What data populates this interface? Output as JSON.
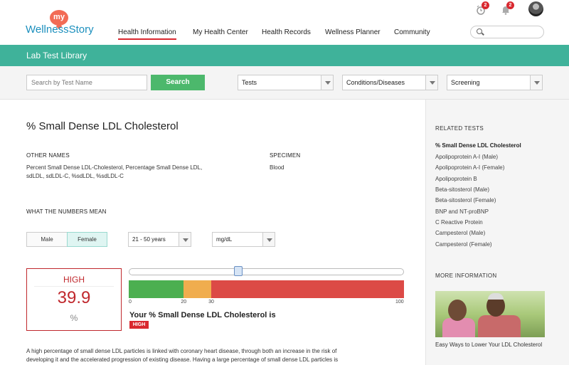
{
  "header": {
    "logo_my": "my",
    "logo_name": "WellnessStory",
    "nav": [
      {
        "label": "Health Information",
        "active": true
      },
      {
        "label": "My Health Center",
        "active": false
      },
      {
        "label": "Health Records",
        "active": false
      },
      {
        "label": "Wellness Planner",
        "active": false
      },
      {
        "label": "Community",
        "active": false
      }
    ],
    "alarm_badge": "2",
    "bell_badge": "2",
    "search_placeholder": ""
  },
  "banner": {
    "title": "Lab Test Library"
  },
  "filters": {
    "search_placeholder": "Search by Test Name",
    "search_button": "Search",
    "dropdowns": [
      "Tests",
      "Conditions/Diseases",
      "Screening"
    ]
  },
  "test": {
    "title": "% Small Dense LDL Cholesterol",
    "other_names_label": "OTHER NAMES",
    "other_names_line1": "Percent Small Dense LDL-Cholesterol, Percentage Small Dense LDL,",
    "other_names_line2": "sdLDL, sdLDL-C, %sdLDL, %sdLDL-C",
    "specimen_label": "SPECIMEN",
    "specimen_value": "Blood",
    "numbers_label": "WHAT THE NUMBERS MEAN",
    "gender_options": [
      "Male",
      "Female"
    ],
    "selected_gender": "Female",
    "age_range": "21 - 50 years",
    "unit_select": "mg/dL"
  },
  "result": {
    "level": "HIGH",
    "value": "39.9",
    "unit": "%",
    "slider_fraction": 0.399,
    "range_ticks": [
      "0",
      "20",
      "30",
      "100"
    ],
    "range_colors": {
      "normal": "#4caf50",
      "borderline": "#f0ad4e",
      "high": "#dc4a46"
    },
    "your_text": "Your % Small Dense LDL Cholesterol is",
    "tag": "HIGH"
  },
  "description": {
    "line1": "A high percentage of small dense LDL particles is linked with coronary heart disease, through both an increase in the risk of",
    "line2": "developing it and the accelerated progression of existing disease. Having a large percentage of small dense LDL particles is"
  },
  "sidebar": {
    "related_heading": "RELATED TESTS",
    "related": [
      "% Small Dense LDL Cholesterol",
      "Apolipoprotein A-I (Male)",
      "Apolipoprotein A-I (Female)",
      "Apolipoprotein B",
      "Beta-sitosterol (Male)",
      "Beta-sitosterol (Female)",
      "BNP and NT-proBNP",
      "C Reactive Protein",
      "Campesterol (Male)",
      "Campesterol (Female)"
    ],
    "more_heading": "MORE INFORMATION",
    "article_caption": "Easy Ways to Lower Your LDL Cholesterol"
  }
}
